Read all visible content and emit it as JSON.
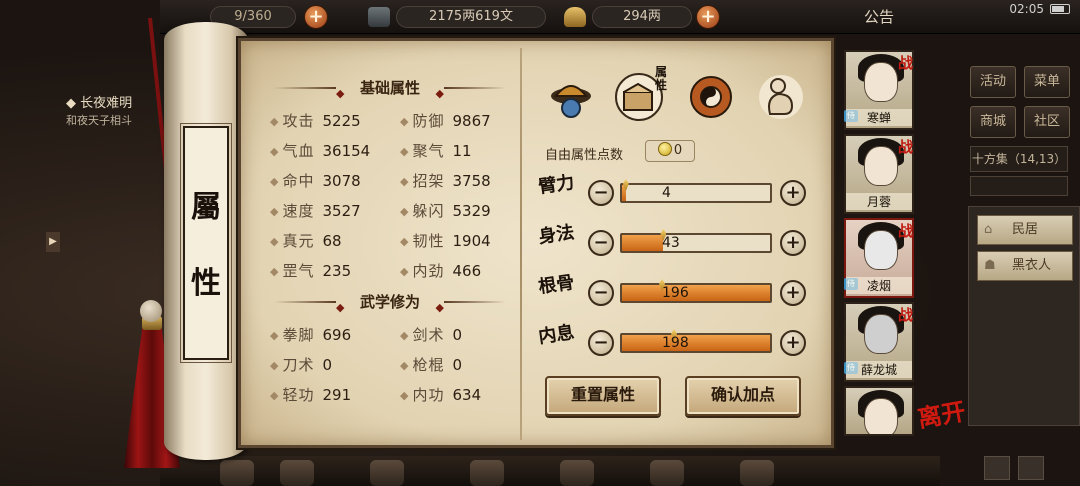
{
  "topbar": {
    "bag_count": "9/360",
    "copper": "2175两619文",
    "silver": "294两",
    "plus_label": "+",
    "notice_label": "公告",
    "clock": "02:05"
  },
  "quest": {
    "title": "长夜难明",
    "desc": "和夜天子相斗"
  },
  "scroll": {
    "title_chars": [
      "屬",
      "性"
    ]
  },
  "basic_stats": {
    "header": "基础属性",
    "left": [
      {
        "label": "攻击",
        "value": "5225"
      },
      {
        "label": "气血",
        "value": "36154"
      },
      {
        "label": "命中",
        "value": "3078"
      },
      {
        "label": "速度",
        "value": "3527"
      },
      {
        "label": "真元",
        "value": "68"
      },
      {
        "label": "罡气",
        "value": "235"
      }
    ],
    "right": [
      {
        "label": "防御",
        "value": "9867"
      },
      {
        "label": "聚气",
        "value": "11"
      },
      {
        "label": "招架",
        "value": "3758"
      },
      {
        "label": "躲闪",
        "value": "5329"
      },
      {
        "label": "韧性",
        "value": "1904"
      },
      {
        "label": "内劲",
        "value": "466"
      }
    ]
  },
  "martial_stats": {
    "header": "武学修为",
    "left": [
      {
        "label": "拳脚",
        "value": "696"
      },
      {
        "label": "刀术",
        "value": "0"
      },
      {
        "label": "轻功",
        "value": "291"
      }
    ],
    "right": [
      {
        "label": "剑术",
        "value": "0"
      },
      {
        "label": "枪棍",
        "value": "0"
      },
      {
        "label": "内功",
        "value": "634"
      }
    ]
  },
  "categories": {
    "active_label": "属性",
    "icons": [
      "hat-icon",
      "chest-icon",
      "bagua-icon",
      "meridian-icon"
    ]
  },
  "allocation": {
    "free_points_label": "自由属性点数",
    "free_points_value": "0",
    "minus_label": "−",
    "plus_label": "+",
    "attributes": [
      {
        "name": "臂力",
        "value": "4",
        "fill": 0.026
      },
      {
        "name": "身法",
        "value": "43",
        "fill": 0.28
      },
      {
        "name": "根骨",
        "value": "196",
        "fill": 1.0
      },
      {
        "name": "内息",
        "value": "198",
        "fill": 1.0
      }
    ],
    "reset_label": "重置属性",
    "confirm_label": "确认加点"
  },
  "party": [
    {
      "name": "寒蝉",
      "badge": "战",
      "tag": "侍"
    },
    {
      "name": "月蓉",
      "badge": "战",
      "tag": ""
    },
    {
      "name": "凌烟",
      "badge": "战",
      "tag": "侍"
    },
    {
      "name": "薛龙城",
      "badge": "战",
      "tag": "侍"
    },
    {
      "name": "",
      "badge": "",
      "tag": ""
    }
  ],
  "leave_label": "离开",
  "side_menu": {
    "row1": [
      "活动",
      "菜单"
    ],
    "row2": [
      "商城",
      "社区"
    ],
    "location": "十方集（14,13）",
    "npcs": [
      "民居",
      "黑衣人"
    ]
  },
  "colors": {
    "parchment": "#e8dcc2",
    "accent_red": "#c01a10",
    "bar_fill": "#e58a2c"
  }
}
